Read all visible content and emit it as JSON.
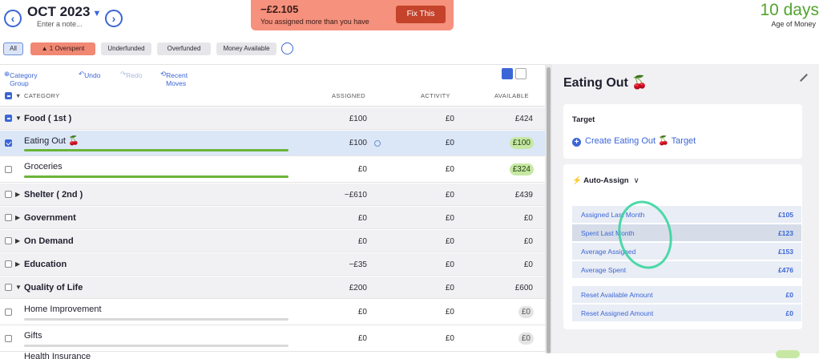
{
  "header": {
    "month": "OCT 2023",
    "note_placeholder": "Enter a note...",
    "alert_amount": "−£2.105",
    "alert_message": "You assigned more than you have",
    "fix_label": "Fix This",
    "age_value": "10 days",
    "age_label": "Age of Money"
  },
  "filters": [
    "All",
    "1 Overspent",
    "Underfunded",
    "Overfunded",
    "Money Available"
  ],
  "toolbar": {
    "category_group": "Category Group",
    "undo": "Undo",
    "redo": "Redo",
    "recent_moves": "Recent Moves"
  },
  "table": {
    "headers": {
      "category": "CATEGORY",
      "assigned": "ASSIGNED",
      "activity": "ACTIVITY",
      "available": "AVAILABLE"
    },
    "rows": [
      {
        "type": "group",
        "name": "Food ( 1st )",
        "assigned": "£100",
        "activity": "£0",
        "available": "£424"
      },
      {
        "type": "cat",
        "name": "Eating Out 🍒",
        "assigned": "£100",
        "activity": "£0",
        "available": "£100"
      },
      {
        "type": "cat",
        "name": "Groceries",
        "assigned": "£0",
        "activity": "£0",
        "available": "£324"
      },
      {
        "type": "group",
        "name": "Shelter ( 2nd )",
        "assigned": "−£610",
        "activity": "£0",
        "available": "£439"
      },
      {
        "type": "group",
        "name": "Government",
        "assigned": "£0",
        "activity": "£0",
        "available": "£0"
      },
      {
        "type": "group",
        "name": "On Demand",
        "assigned": "£0",
        "activity": "£0",
        "available": "£0"
      },
      {
        "type": "group",
        "name": "Education",
        "assigned": "−£35",
        "activity": "£0",
        "available": "£0"
      },
      {
        "type": "group",
        "name": "Quality of Life",
        "assigned": "£200",
        "activity": "£0",
        "available": "£600"
      },
      {
        "type": "cat",
        "name": "Home Improvement",
        "assigned": "£0",
        "activity": "£0",
        "available": "£0"
      },
      {
        "type": "cat",
        "name": "Gifts",
        "assigned": "£0",
        "activity": "£0",
        "available": "£0"
      },
      {
        "type": "cat",
        "name": "Health Insurance",
        "assigned": "",
        "activity": "",
        "available": ""
      }
    ]
  },
  "inspector": {
    "title": "Eating Out 🍒",
    "target_heading": "Target",
    "target_link": "Create Eating Out 🍒 Target",
    "auto_assign": "Auto-Assign",
    "stats": [
      {
        "label": "Assigned Last Month",
        "value": "£105"
      },
      {
        "label": "Spent Last Month",
        "value": "£123"
      },
      {
        "label": "Average Assigned",
        "value": "£153"
      },
      {
        "label": "Average Spent",
        "value": "£476"
      }
    ],
    "resets": [
      {
        "label": "Reset Available Amount",
        "value": "£0"
      },
      {
        "label": "Reset Assigned Amount",
        "value": "£0"
      }
    ]
  }
}
